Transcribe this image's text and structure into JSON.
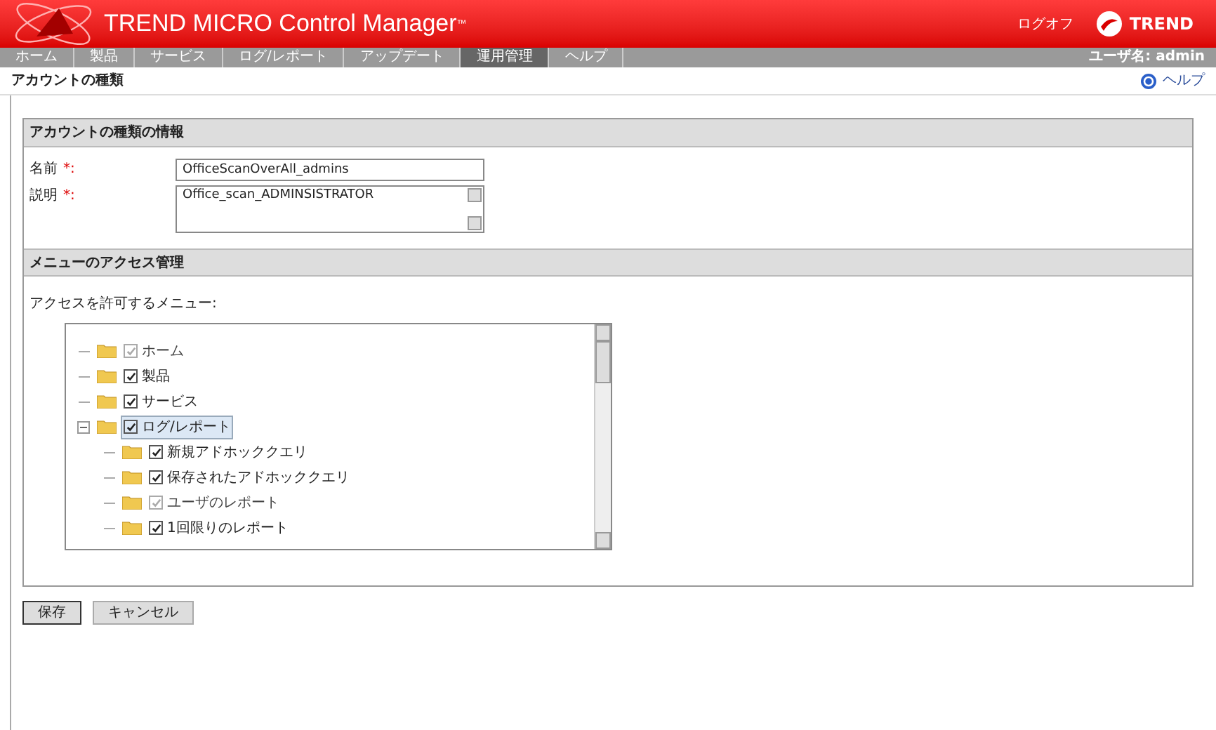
{
  "header": {
    "product": "TREND MICRO Control Manager",
    "trademark": "™",
    "logoff": "ログオフ",
    "brand": "TREND"
  },
  "nav": {
    "tabs": [
      {
        "label": "ホーム",
        "selected": false
      },
      {
        "label": "製品",
        "selected": false
      },
      {
        "label": "サービス",
        "selected": false
      },
      {
        "label": "ログ/レポート",
        "selected": false
      },
      {
        "label": "アップデート",
        "selected": false
      },
      {
        "label": "運用管理",
        "selected": true
      },
      {
        "label": "ヘルプ",
        "selected": false
      }
    ],
    "user": "ユーザ名: admin"
  },
  "page": {
    "title": "アカウントの種類",
    "help": "ヘルプ"
  },
  "info": {
    "heading": "アカウントの種類の情報",
    "fields": [
      {
        "label": "名前",
        "required": "*:",
        "value": "OfficeScanOverAll_admins",
        "kind": "text"
      },
      {
        "label": "説明",
        "required": "*:",
        "value": "Office_scan_ADMINSISTRATOR",
        "kind": "textarea"
      }
    ]
  },
  "access": {
    "heading": "メニューのアクセス管理",
    "prompt": "アクセスを許可するメニュー:",
    "tree": [
      {
        "label": "ホーム",
        "checked": true,
        "disabled": true,
        "selected": false
      },
      {
        "label": "製品",
        "checked": true,
        "disabled": false,
        "selected": false
      },
      {
        "label": "サービス",
        "checked": true,
        "disabled": false,
        "selected": false
      },
      {
        "label": "ログ/レポート",
        "checked": true,
        "disabled": false,
        "selected": true,
        "expanded": true,
        "children": [
          {
            "label": "新規アドホッククエリ",
            "checked": true,
            "disabled": false,
            "selected": false
          },
          {
            "label": "保存されたアドホッククエリ",
            "checked": true,
            "disabled": false,
            "selected": false
          },
          {
            "label": "ユーザのレポート",
            "checked": true,
            "disabled": true,
            "selected": false
          },
          {
            "label": "1回限りのレポート",
            "checked": true,
            "disabled": false,
            "selected": false
          }
        ]
      }
    ]
  },
  "buttons": [
    "保存",
    "キャンセル"
  ]
}
